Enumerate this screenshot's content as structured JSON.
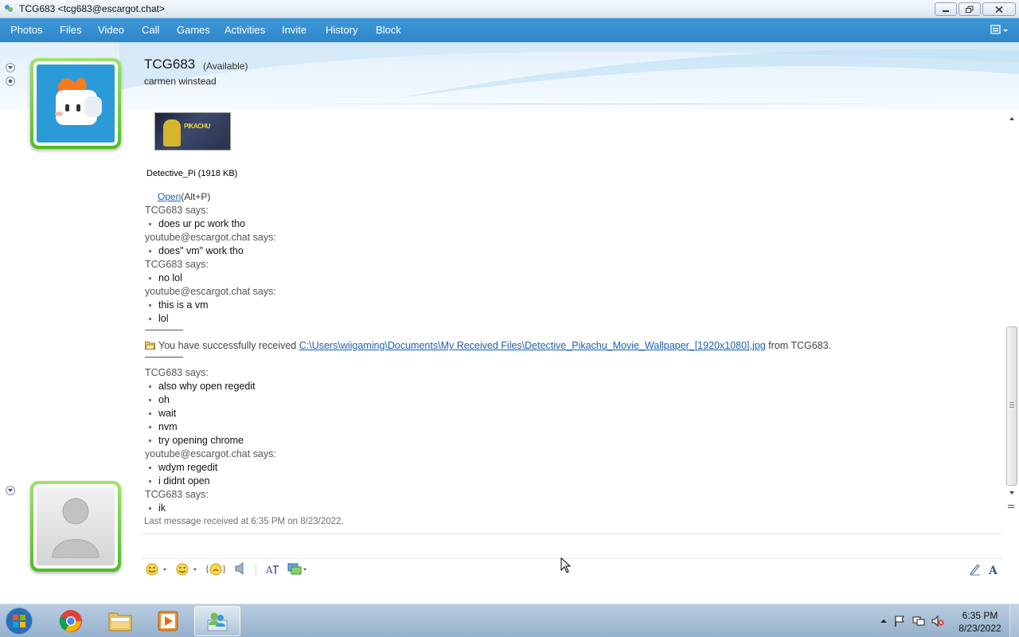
{
  "window": {
    "title": "TCG683 <tcg683@escargot.chat>"
  },
  "menu": [
    "Photos",
    "Files",
    "Video",
    "Call",
    "Games",
    "Activities",
    "Invite",
    "History",
    "Block"
  ],
  "contact": {
    "name": "TCG683",
    "status": "(Available)",
    "personal_message": "carmen winstead"
  },
  "file_transfer": {
    "caption": "Detective_Pi (1918 KB)",
    "open_link": "Open",
    "open_shortcut": "(Alt+P)",
    "thumbnail_text": "PIKACHU"
  },
  "conversation": [
    {
      "sender": "TCG683 says:",
      "messages": [
        "does ur pc work tho"
      ]
    },
    {
      "sender": "youtube@escargot.chat says:",
      "messages": [
        "does\" vm\" work tho"
      ]
    },
    {
      "sender": "TCG683 says:",
      "messages": [
        "no lol"
      ]
    },
    {
      "sender": "youtube@escargot.chat says:",
      "messages": [
        "this is a vm",
        "lol"
      ]
    }
  ],
  "received_notice": {
    "prefix": "You have successfully received",
    "path": "C:\\Users\\wiigaming\\Documents\\My Received Files\\Detective_Pikachu_Movie_Wallpaper_[1920x1080].jpg",
    "suffix": "from TCG683."
  },
  "conversation2": [
    {
      "sender": "TCG683 says:",
      "messages": [
        "also why open regedit",
        "oh",
        "wait",
        "nvm",
        "try opening chrome"
      ]
    },
    {
      "sender": "youtube@escargot.chat says:",
      "messages": [
        "wdym regedit",
        "i didnt open"
      ]
    },
    {
      "sender": "TCG683 says:",
      "messages": [
        "ik"
      ]
    }
  ],
  "last_message": "Last message received at 6:35 PM on 8/23/2022.",
  "input": {
    "value": "",
    "placeholder": ""
  },
  "taskbar": {
    "time": "6:35 PM",
    "date": "8/23/2022"
  },
  "colors": {
    "menubar": "#3d98d8",
    "link": "#1d5fb0",
    "avatar_frame": "#4fbd23"
  }
}
